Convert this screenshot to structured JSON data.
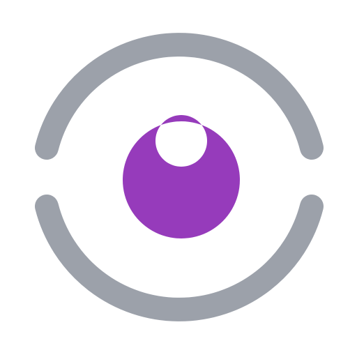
{
  "logo": {
    "icon": "eye-logo-icon",
    "ring_color": "#9CA1AA",
    "pupil_color": "#963BBB",
    "background_color": "#FFFFFF"
  }
}
